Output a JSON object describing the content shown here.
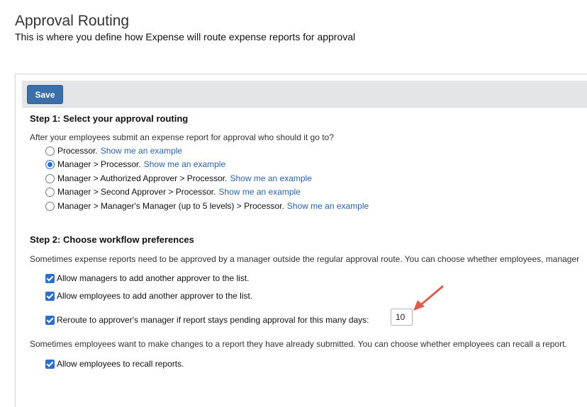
{
  "page": {
    "title": "Approval Routing",
    "subtitle": "This is where you define how Expense will route expense reports for approval"
  },
  "toolbar": {
    "save_label": "Save"
  },
  "step1": {
    "heading": "Step 1: Select your approval routing",
    "question": "After your employees submit an expense report for approval who should it go to?",
    "options": [
      {
        "label": "Processor.",
        "link": "Show me an example",
        "checked": false
      },
      {
        "label": "Manager > Processor.",
        "link": "Show me an example",
        "checked": true
      },
      {
        "label": "Manager > Authorized Approver > Processor.",
        "link": "Show me an example",
        "checked": false
      },
      {
        "label": "Manager > Second Approver > Processor.",
        "link": "Show me an example",
        "checked": false
      },
      {
        "label": "Manager > Manager's Manager (up to 5 levels) > Processor.",
        "link": "Show me an example",
        "checked": false
      }
    ]
  },
  "step2": {
    "heading": "Step 2: Choose workflow preferences",
    "desc1": "Sometimes expense reports need to be approved by a manager outside the regular approval route. You can choose whether employees, manager",
    "checks": [
      {
        "label": "Allow managers to add another approver to the list.",
        "checked": true
      },
      {
        "label": "Allow employees to add another approver to the list.",
        "checked": true
      },
      {
        "label": "Reroute to approver's manager if report stays pending approval for this many days:",
        "checked": true
      }
    ],
    "days_value": "10",
    "desc2": "Sometimes employees want to make changes to a report they have already submitted. You can choose whether employees can recall a report.",
    "recall": {
      "label": "Allow employees to recall reports.",
      "checked": true
    }
  },
  "colors": {
    "accent": "#3b6faa",
    "link": "#2d62a4",
    "checkbox": "#2a6fd0",
    "arrow": "#e05a4e"
  }
}
